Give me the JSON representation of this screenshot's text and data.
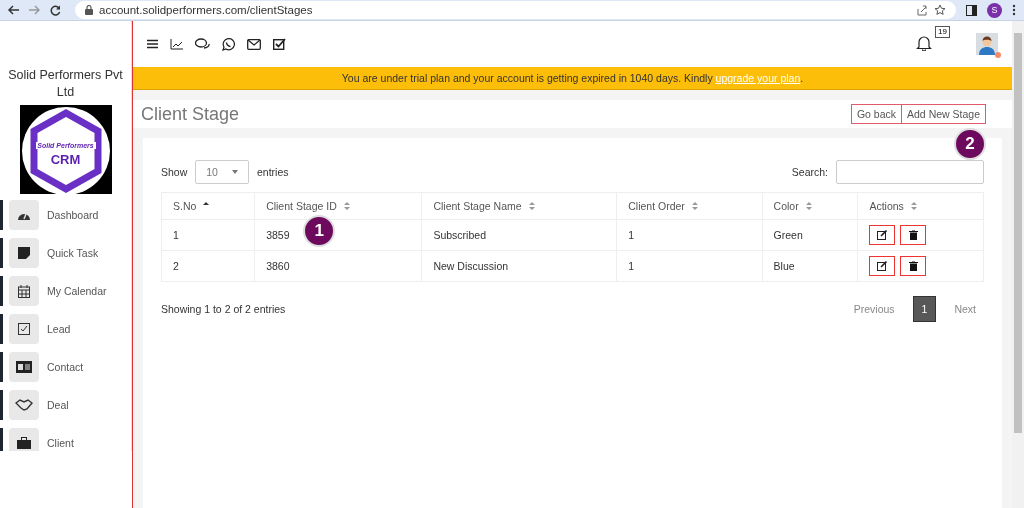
{
  "browser": {
    "url": "account.solidperformers.com/clientStages",
    "profile_initial": "S"
  },
  "sidebar": {
    "company": "Solid Performers Pvt Ltd",
    "logo_top": "Solid Performers",
    "logo_bottom": "CRM",
    "items": [
      {
        "label": "Dashboard"
      },
      {
        "label": "Quick Task"
      },
      {
        "label": "My Calendar"
      },
      {
        "label": "Lead"
      },
      {
        "label": "Contact"
      },
      {
        "label": "Deal"
      },
      {
        "label": "Client"
      }
    ]
  },
  "topbar": {
    "notification_count": "19"
  },
  "banner": {
    "text": "You are under trial plan and your account is getting expired in 1040 days. Kindly ",
    "link": "upgrade your plan",
    "end": "."
  },
  "page": {
    "title": "Client Stage",
    "buttons": [
      "Go back",
      "Add New Stage"
    ]
  },
  "table_controls": {
    "show": "Show",
    "page_size": "10",
    "entries": "entries",
    "search_label": "Search:"
  },
  "table": {
    "columns": [
      {
        "label": "S.No",
        "sorted": true
      },
      {
        "label": "Client Stage ID",
        "sorted": false
      },
      {
        "label": "Client Stage Name",
        "sorted": false
      },
      {
        "label": "Client Order",
        "sorted": false
      },
      {
        "label": "Color",
        "sorted": false
      },
      {
        "label": "Actions",
        "sorted": false
      }
    ],
    "rows": [
      {
        "sno": "1",
        "id": "3859",
        "name": "Subscribed",
        "order": "1",
        "color_name": "Green"
      },
      {
        "sno": "2",
        "id": "3860",
        "name": "New Discussion",
        "order": "1",
        "color_name": "Blue"
      }
    ]
  },
  "info": "Showing 1 to 2 of 2 entries",
  "pagination": [
    {
      "label": "Previous",
      "selected": false
    },
    {
      "label": "1",
      "selected": true
    },
    {
      "label": "Next",
      "selected": false
    }
  ],
  "callouts": [
    "1",
    "2"
  ]
}
